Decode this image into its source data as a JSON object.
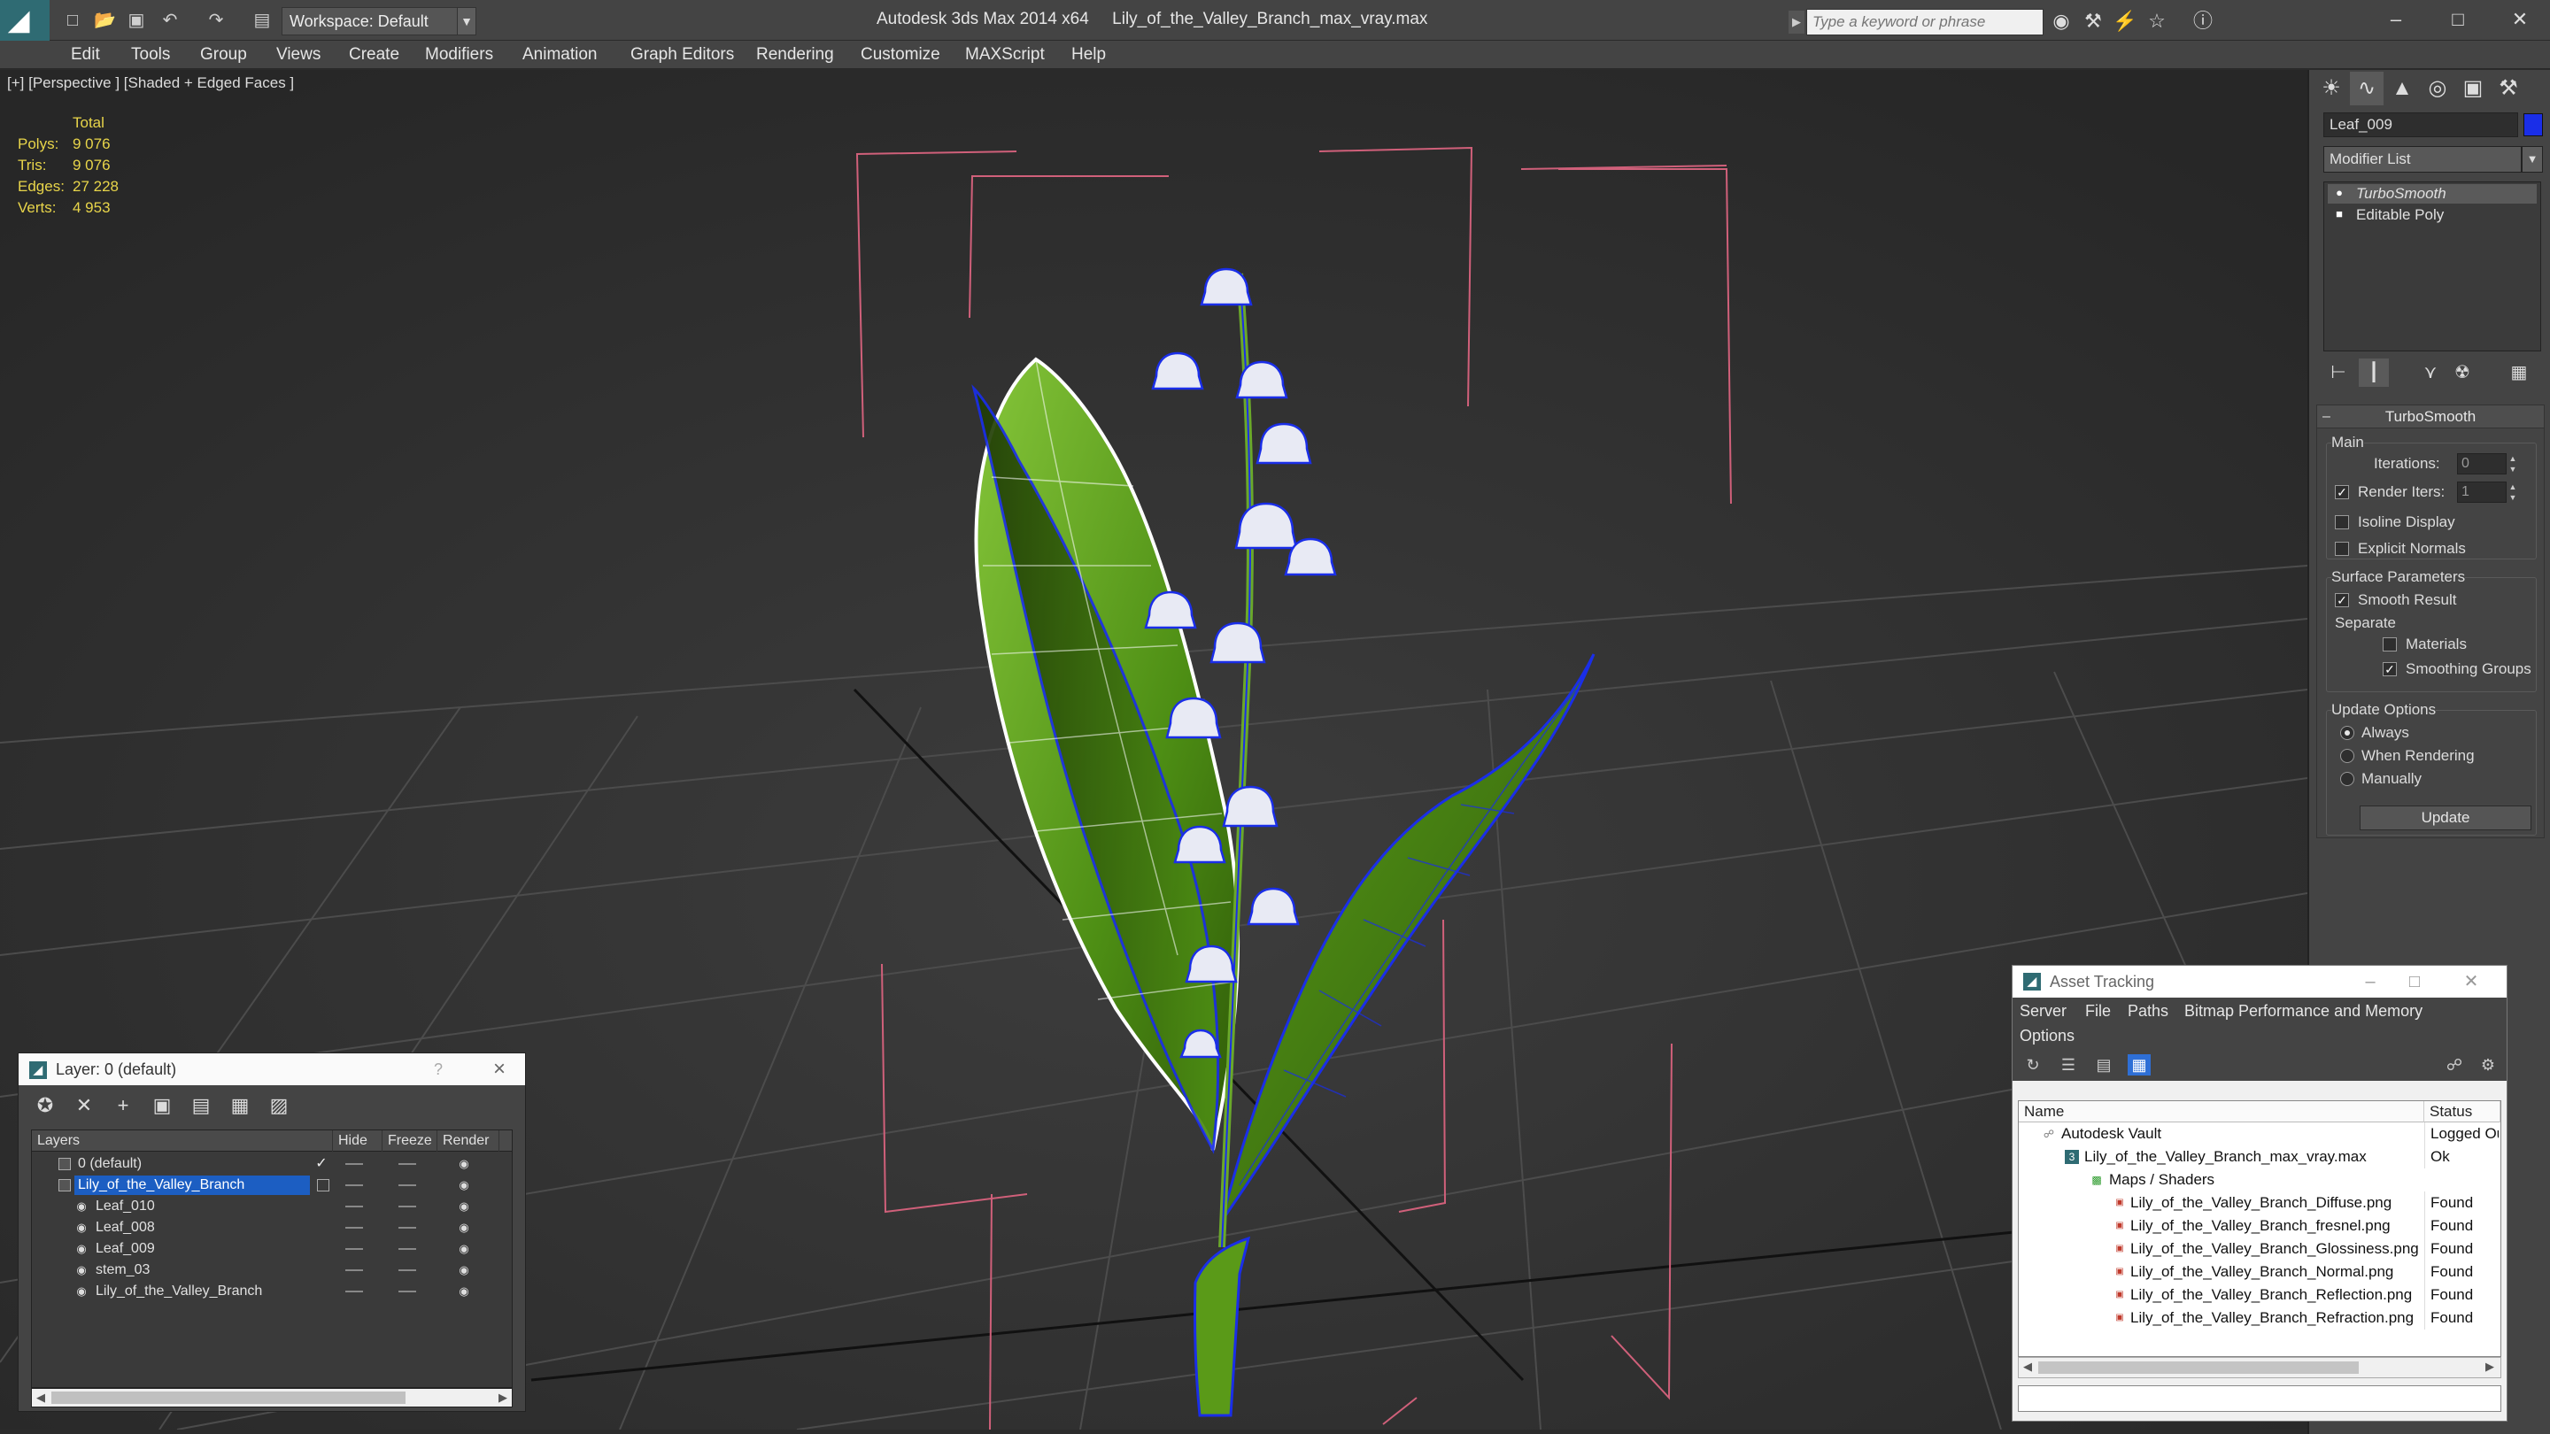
{
  "app": {
    "title": "Autodesk 3ds Max  2014 x64",
    "file": "Lily_of_the_Valley_Branch_max_vray.max",
    "workspace": "Workspace: Default",
    "search_placeholder": "Type a keyword or phrase"
  },
  "menu": [
    "Edit",
    "Tools",
    "Group",
    "Views",
    "Create",
    "Modifiers",
    "Animation",
    "Graph Editors",
    "Rendering",
    "Customize",
    "MAXScript",
    "Help"
  ],
  "viewport": {
    "label": "[+] [Perspective ] [Shaded + Edged Faces ]",
    "stats": {
      "header": "Total",
      "rows": [
        {
          "label": "Polys:",
          "value": "9 076"
        },
        {
          "label": "Tris:",
          "value": "9 076"
        },
        {
          "label": "Edges:",
          "value": "27 228"
        },
        {
          "label": "Verts:",
          "value": "4 953"
        }
      ]
    }
  },
  "command_panel": {
    "object_name": "Leaf_009",
    "object_color": "#1a2ee8",
    "modifier_list": "Modifier List",
    "stack": [
      "TurboSmooth",
      "Editable Poly"
    ],
    "rollout": {
      "title": "TurboSmooth",
      "main_group": "Main",
      "iterations_label": "Iterations:",
      "iterations_value": "0",
      "render_iters_label": "Render Iters:",
      "render_iters_value": "1",
      "render_iters_checked": true,
      "isoline_label": "Isoline Display",
      "explicit_normals_label": "Explicit Normals",
      "surface_group": "Surface Parameters",
      "smooth_result_label": "Smooth Result",
      "separate_label": "Separate",
      "materials_label": "Materials",
      "smoothing_groups_label": "Smoothing Groups",
      "update_group": "Update Options",
      "always_label": "Always",
      "when_rendering_label": "When Rendering",
      "manually_label": "Manually",
      "update_button": "Update"
    }
  },
  "layer_window": {
    "title": "Layer: 0 (default)",
    "help": "?",
    "columns": [
      "Layers",
      "Hide",
      "Freeze",
      "Render"
    ],
    "rows": [
      {
        "name": "0 (default)",
        "level": 1,
        "active": true
      },
      {
        "name": "Lily_of_the_Valley_Branch",
        "level": 1,
        "selected": true
      },
      {
        "name": "Leaf_010",
        "level": 2
      },
      {
        "name": "Leaf_008",
        "level": 2
      },
      {
        "name": "Leaf_009",
        "level": 2
      },
      {
        "name": "stem_03",
        "level": 2
      },
      {
        "name": "Lily_of_the_Valley_Branch",
        "level": 2
      }
    ]
  },
  "asset_window": {
    "title": "Asset Tracking",
    "menu": [
      "Server",
      "File",
      "Paths",
      "Bitmap Performance and Memory",
      "Options"
    ],
    "columns": [
      "Name",
      "Status"
    ],
    "rows": [
      {
        "name": "Autodesk Vault",
        "status": "Logged Out",
        "level": 1
      },
      {
        "name": "Lily_of_the_Valley_Branch_max_vray.max",
        "status": "Ok",
        "level": 2
      },
      {
        "name": "Maps / Shaders",
        "status": "",
        "level": 3
      },
      {
        "name": "Lily_of_the_Valley_Branch_Diffuse.png",
        "status": "Found",
        "level": 4
      },
      {
        "name": "Lily_of_the_Valley_Branch_fresnel.png",
        "status": "Found",
        "level": 4
      },
      {
        "name": "Lily_of_the_Valley_Branch_Glossiness.png",
        "status": "Found",
        "level": 4
      },
      {
        "name": "Lily_of_the_Valley_Branch_Normal.png",
        "status": "Found",
        "level": 4
      },
      {
        "name": "Lily_of_the_Valley_Branch_Reflection.png",
        "status": "Found",
        "level": 4
      },
      {
        "name": "Lily_of_the_Valley_Branch_Refraction.png",
        "status": "Found",
        "level": 4
      }
    ]
  },
  "colors": {
    "accent_blue": "#1c5ec2",
    "stats_yellow": "#e8d54a",
    "bbox_pink": "#d0607a",
    "leaf_green": "#5da21b"
  }
}
